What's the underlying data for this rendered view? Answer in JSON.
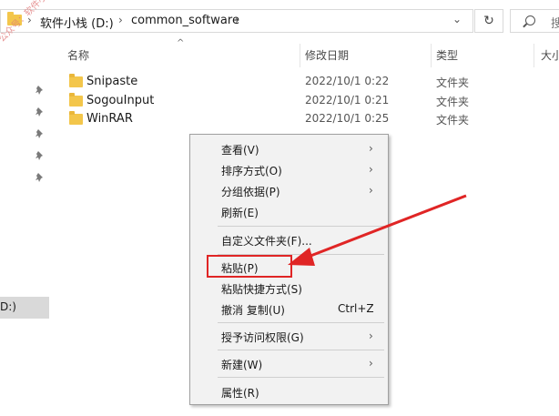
{
  "address_bar": {
    "crumbs": [
      "软件小栈 (D:)",
      "common_software"
    ],
    "search_placeholder": "搜"
  },
  "watermark": "公众号：软件小栈",
  "columns": [
    "名称",
    "修改日期",
    "类型",
    "大小"
  ],
  "files": [
    {
      "name": "Snipaste",
      "date": "2022/10/1 0:22",
      "type": "文件夹"
    },
    {
      "name": "SogouInput",
      "date": "2022/10/1 0:21",
      "type": "文件夹"
    },
    {
      "name": "WinRAR",
      "date": "2022/10/1 0:25",
      "type": "文件夹"
    }
  ],
  "nav": {
    "selected_label": "D:)"
  },
  "context_menu": {
    "items": [
      {
        "label": "查看(V)",
        "submenu": true
      },
      {
        "label": "排序方式(O)",
        "submenu": true
      },
      {
        "label": "分组依据(P)",
        "submenu": true
      },
      {
        "label": "刷新(E)"
      },
      {
        "label": "自定义文件夹(F)..."
      },
      {
        "label": "粘贴(P)",
        "highlighted": true
      },
      {
        "label": "粘贴快捷方式(S)"
      },
      {
        "label": "撤消 复制(U)",
        "shortcut": "Ctrl+Z"
      },
      {
        "label": "授予访问权限(G)",
        "submenu": true
      },
      {
        "label": "新建(W)",
        "submenu": true
      },
      {
        "label": "属性(R)"
      }
    ]
  },
  "colors": {
    "highlight": "#e02525",
    "folder": "#f3c64b"
  },
  "icons": [
    "folder-icon",
    "chevron-right-icon",
    "refresh-icon",
    "search-icon",
    "pin-icon",
    "sort-up-icon"
  ]
}
